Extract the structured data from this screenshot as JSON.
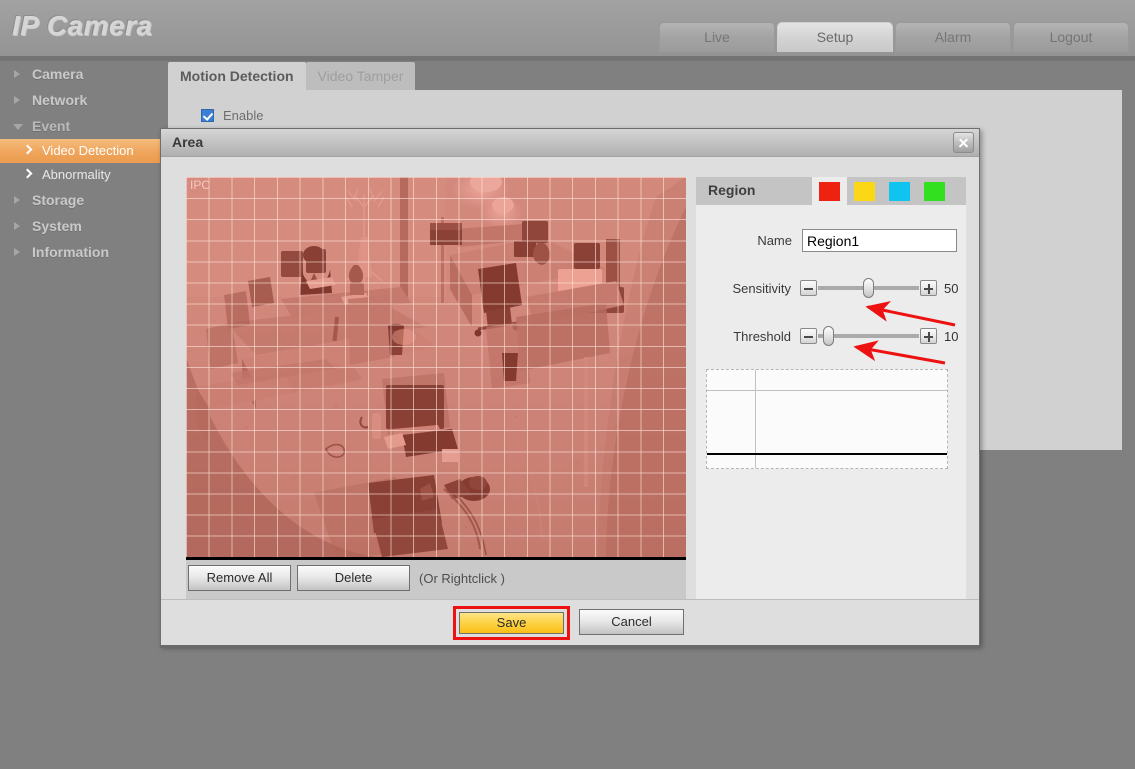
{
  "header": {
    "brand_ip": "IP",
    "brand_camera": "Camera",
    "nav": [
      {
        "label": "Live",
        "active": false
      },
      {
        "label": "Setup",
        "active": true
      },
      {
        "label": "Alarm",
        "active": false
      },
      {
        "label": "Logout",
        "active": false
      }
    ]
  },
  "sidebar": {
    "items": [
      {
        "label": "Camera"
      },
      {
        "label": "Network"
      },
      {
        "label": "Event"
      }
    ],
    "sub_items": [
      {
        "label": "Video Detection",
        "selected": true
      },
      {
        "label": "Abnormality",
        "selected": false
      }
    ],
    "items_after": [
      {
        "label": "Storage"
      },
      {
        "label": "System"
      },
      {
        "label": "Information"
      }
    ]
  },
  "content": {
    "tabs": [
      {
        "label": "Motion Detection",
        "active": true
      },
      {
        "label": "Video Tamper",
        "active": false
      }
    ],
    "enable_label": "Enable"
  },
  "dialog": {
    "title": "Area",
    "close_icon": "close-icon",
    "video": {
      "watermark": "IPC",
      "overlay_color": "#d64632"
    },
    "toolbar": {
      "remove_all_label": "Remove All",
      "delete_label": "Delete",
      "hint": "(Or Rightclick )"
    },
    "region": {
      "title": "Region",
      "swatches": [
        {
          "name": "red",
          "color": "#ee2211",
          "selected": true
        },
        {
          "name": "yellow",
          "color": "#fbd716",
          "selected": false
        },
        {
          "name": "cyan",
          "color": "#10c4f0",
          "selected": false
        },
        {
          "name": "green",
          "color": "#33e020",
          "selected": false
        }
      ],
      "name_label": "Name",
      "name_value": "Region1",
      "sensitivity_label": "Sensitivity",
      "sensitivity_value": "50",
      "threshold_label": "Threshold",
      "threshold_value": "10"
    },
    "footer": {
      "save_label": "Save",
      "cancel_label": "Cancel"
    }
  }
}
